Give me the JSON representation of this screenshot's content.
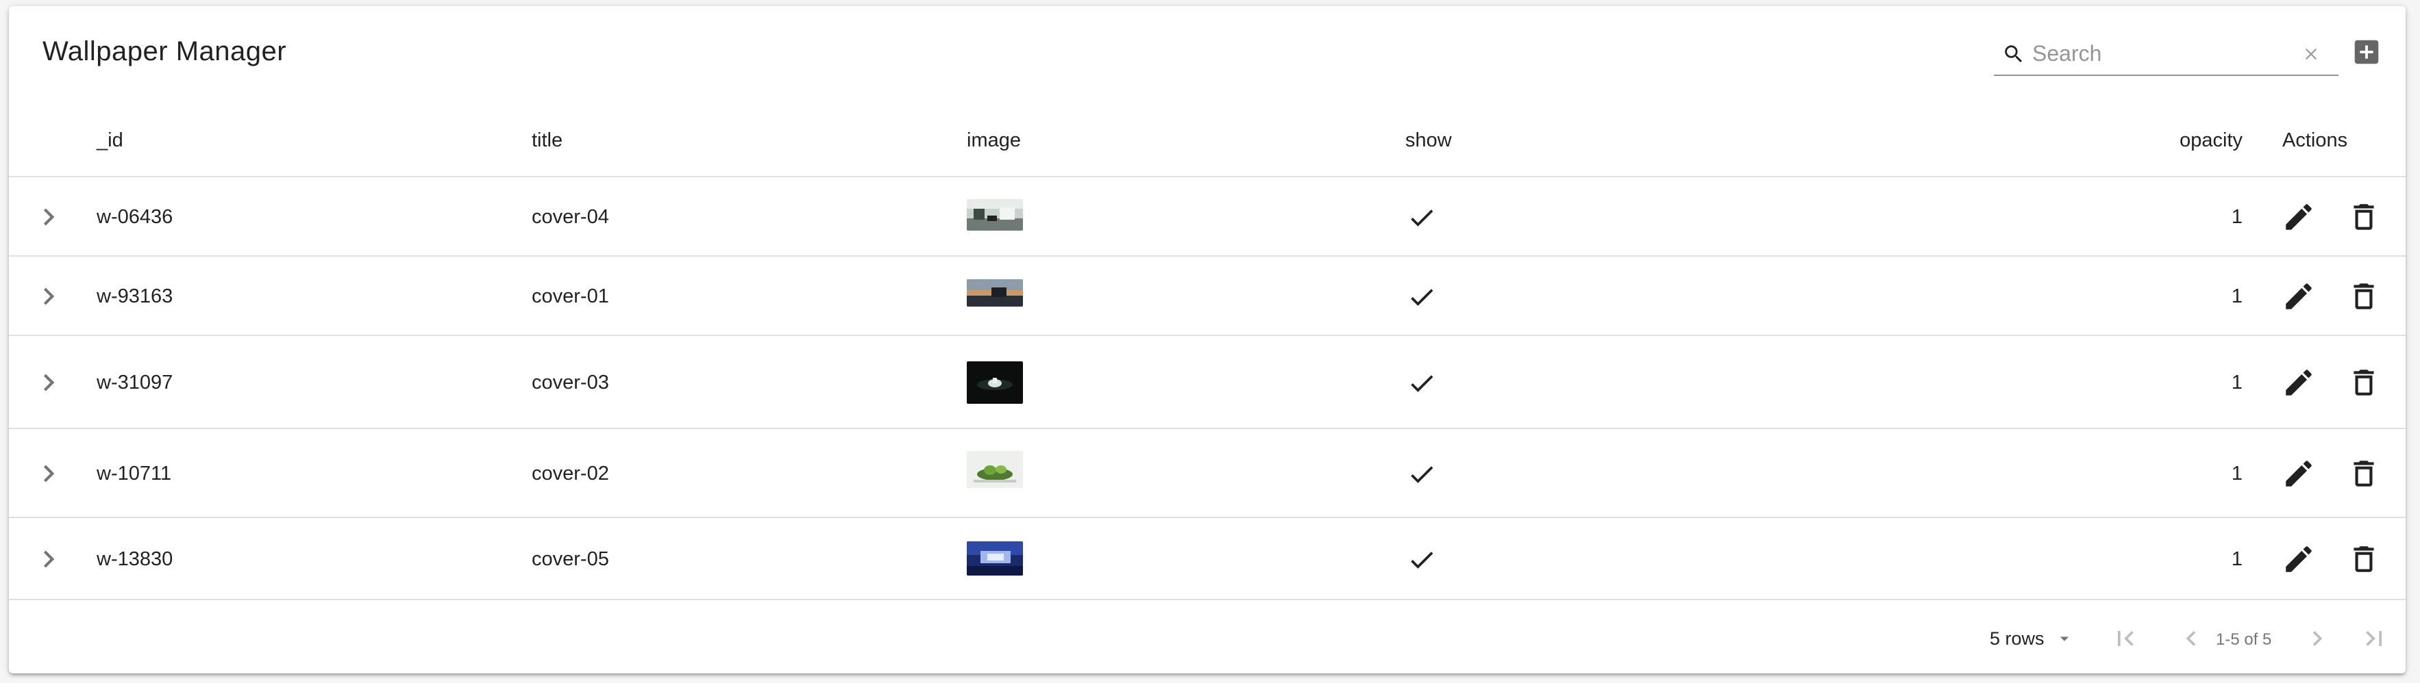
{
  "toolbar": {
    "title": "Wallpaper Manager",
    "search_placeholder": "Search",
    "search_value": ""
  },
  "columns": {
    "id": "_id",
    "title": "title",
    "image": "image",
    "show": "show",
    "opacity": "opacity",
    "actions": "Actions"
  },
  "rows": [
    {
      "id": "w-06436",
      "title": "cover-04",
      "show": true,
      "opacity": "1"
    },
    {
      "id": "w-93163",
      "title": "cover-01",
      "show": true,
      "opacity": "1"
    },
    {
      "id": "w-31097",
      "title": "cover-03",
      "show": true,
      "opacity": "1"
    },
    {
      "id": "w-10711",
      "title": "cover-02",
      "show": true,
      "opacity": "1"
    },
    {
      "id": "w-13830",
      "title": "cover-05",
      "show": true,
      "opacity": "1"
    }
  ],
  "pagination": {
    "rows_per_page": "5 rows",
    "range": "1-5 of 5"
  },
  "icons": {
    "search": "search-icon",
    "clear": "close-icon",
    "add": "add-box-icon",
    "expand": "chevron-right-icon",
    "check": "check-icon",
    "edit": "pencil-icon",
    "delete": "trash-icon",
    "dropdown": "arrow-drop-down-icon",
    "first": "first-page-icon",
    "prev": "chevron-left-icon",
    "next": "chevron-right-icon",
    "last": "last-page-icon"
  }
}
